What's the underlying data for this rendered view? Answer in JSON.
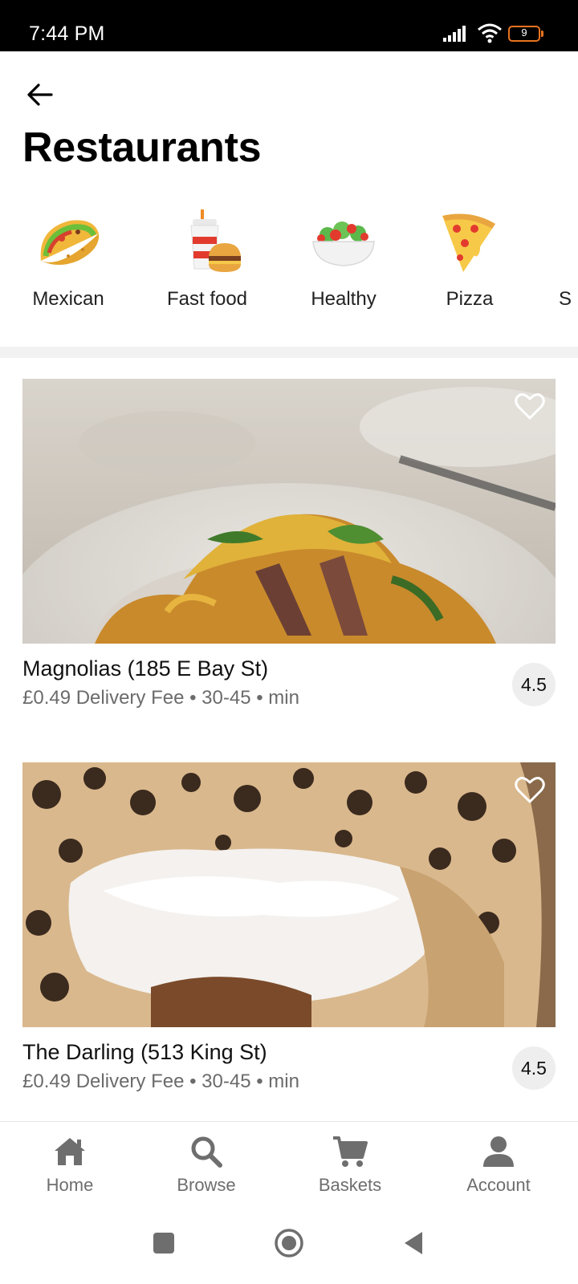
{
  "status_bar": {
    "time": "7:44 PM",
    "battery_level": "9",
    "icons": [
      "signal-icon",
      "wifi-icon",
      "battery-icon"
    ]
  },
  "header": {
    "back_icon": "back-arrow-icon",
    "title": "Restaurants"
  },
  "categories": [
    {
      "label": "Mexican",
      "icon": "taco-icon"
    },
    {
      "label": "Fast food",
      "icon": "fast-food-icon"
    },
    {
      "label": "Healthy",
      "icon": "salad-icon"
    },
    {
      "label": "Pizza",
      "icon": "pizza-icon"
    },
    {
      "label": "S",
      "icon": ""
    }
  ],
  "restaurants": [
    {
      "name": "Magnolias (185 E Bay St)",
      "meta": "£0.49 Delivery Fee • 30-45 • min",
      "rating": "4.5",
      "favorite_icon": "heart-outline-icon"
    },
    {
      "name": "The Darling (513 King St)",
      "meta": "£0.49 Delivery Fee • 30-45 • min",
      "rating": "4.5",
      "favorite_icon": "heart-outline-icon"
    }
  ],
  "bottom_nav": [
    {
      "label": "Home",
      "icon": "home-icon"
    },
    {
      "label": "Browse",
      "icon": "search-icon"
    },
    {
      "label": "Baskets",
      "icon": "cart-icon"
    },
    {
      "label": "Account",
      "icon": "account-icon"
    }
  ],
  "system_nav": [
    "recents-icon",
    "home-circle-icon",
    "back-triangle-icon"
  ],
  "colors": {
    "battery_accent": "#e8731f",
    "nav_icon": "#6e6e6e",
    "muted_text": "#6b6b6b"
  }
}
